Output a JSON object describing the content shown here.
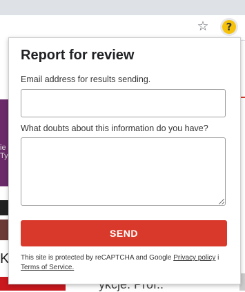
{
  "browser": {
    "bookmark_icon": "star-outline-icon",
    "extension_icon": "question-mark-icon",
    "extension_glyph": "?",
    "extension_color": "#f6c20a"
  },
  "background_page": {
    "left_fragment": "ie\nTy",
    "letter_fragment": "K",
    "bottom_text": "ykcje. Prof..",
    "chevron": "˅"
  },
  "popup": {
    "title": "Report for review",
    "email_label": "Email address for results sending.",
    "email_value": "",
    "doubts_label": "What doubts about this information do you have?",
    "doubts_value": "",
    "send_label": "SEND",
    "send_color": "#d9392b",
    "recaptcha_prefix": "This site is protected by reCAPTCHA and Google",
    "privacy_link": "Privacy policy",
    "conjunction": "i",
    "terms_link": "Terms of Service."
  }
}
